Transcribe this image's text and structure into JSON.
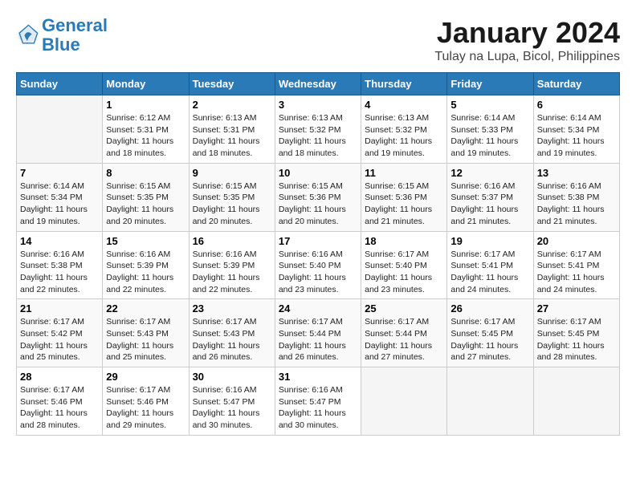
{
  "logo": {
    "line1": "General",
    "line2": "Blue"
  },
  "title": "January 2024",
  "subtitle": "Tulay na Lupa, Bicol, Philippines",
  "headers": [
    "Sunday",
    "Monday",
    "Tuesday",
    "Wednesday",
    "Thursday",
    "Friday",
    "Saturday"
  ],
  "weeks": [
    [
      {
        "day": "",
        "info": ""
      },
      {
        "day": "1",
        "info": "Sunrise: 6:12 AM\nSunset: 5:31 PM\nDaylight: 11 hours\nand 18 minutes."
      },
      {
        "day": "2",
        "info": "Sunrise: 6:13 AM\nSunset: 5:31 PM\nDaylight: 11 hours\nand 18 minutes."
      },
      {
        "day": "3",
        "info": "Sunrise: 6:13 AM\nSunset: 5:32 PM\nDaylight: 11 hours\nand 18 minutes."
      },
      {
        "day": "4",
        "info": "Sunrise: 6:13 AM\nSunset: 5:32 PM\nDaylight: 11 hours\nand 19 minutes."
      },
      {
        "day": "5",
        "info": "Sunrise: 6:14 AM\nSunset: 5:33 PM\nDaylight: 11 hours\nand 19 minutes."
      },
      {
        "day": "6",
        "info": "Sunrise: 6:14 AM\nSunset: 5:34 PM\nDaylight: 11 hours\nand 19 minutes."
      }
    ],
    [
      {
        "day": "7",
        "info": "Sunrise: 6:14 AM\nSunset: 5:34 PM\nDaylight: 11 hours\nand 19 minutes."
      },
      {
        "day": "8",
        "info": "Sunrise: 6:15 AM\nSunset: 5:35 PM\nDaylight: 11 hours\nand 20 minutes."
      },
      {
        "day": "9",
        "info": "Sunrise: 6:15 AM\nSunset: 5:35 PM\nDaylight: 11 hours\nand 20 minutes."
      },
      {
        "day": "10",
        "info": "Sunrise: 6:15 AM\nSunset: 5:36 PM\nDaylight: 11 hours\nand 20 minutes."
      },
      {
        "day": "11",
        "info": "Sunrise: 6:15 AM\nSunset: 5:36 PM\nDaylight: 11 hours\nand 21 minutes."
      },
      {
        "day": "12",
        "info": "Sunrise: 6:16 AM\nSunset: 5:37 PM\nDaylight: 11 hours\nand 21 minutes."
      },
      {
        "day": "13",
        "info": "Sunrise: 6:16 AM\nSunset: 5:38 PM\nDaylight: 11 hours\nand 21 minutes."
      }
    ],
    [
      {
        "day": "14",
        "info": "Sunrise: 6:16 AM\nSunset: 5:38 PM\nDaylight: 11 hours\nand 22 minutes."
      },
      {
        "day": "15",
        "info": "Sunrise: 6:16 AM\nSunset: 5:39 PM\nDaylight: 11 hours\nand 22 minutes."
      },
      {
        "day": "16",
        "info": "Sunrise: 6:16 AM\nSunset: 5:39 PM\nDaylight: 11 hours\nand 22 minutes."
      },
      {
        "day": "17",
        "info": "Sunrise: 6:16 AM\nSunset: 5:40 PM\nDaylight: 11 hours\nand 23 minutes."
      },
      {
        "day": "18",
        "info": "Sunrise: 6:17 AM\nSunset: 5:40 PM\nDaylight: 11 hours\nand 23 minutes."
      },
      {
        "day": "19",
        "info": "Sunrise: 6:17 AM\nSunset: 5:41 PM\nDaylight: 11 hours\nand 24 minutes."
      },
      {
        "day": "20",
        "info": "Sunrise: 6:17 AM\nSunset: 5:41 PM\nDaylight: 11 hours\nand 24 minutes."
      }
    ],
    [
      {
        "day": "21",
        "info": "Sunrise: 6:17 AM\nSunset: 5:42 PM\nDaylight: 11 hours\nand 25 minutes."
      },
      {
        "day": "22",
        "info": "Sunrise: 6:17 AM\nSunset: 5:43 PM\nDaylight: 11 hours\nand 25 minutes."
      },
      {
        "day": "23",
        "info": "Sunrise: 6:17 AM\nSunset: 5:43 PM\nDaylight: 11 hours\nand 26 minutes."
      },
      {
        "day": "24",
        "info": "Sunrise: 6:17 AM\nSunset: 5:44 PM\nDaylight: 11 hours\nand 26 minutes."
      },
      {
        "day": "25",
        "info": "Sunrise: 6:17 AM\nSunset: 5:44 PM\nDaylight: 11 hours\nand 27 minutes."
      },
      {
        "day": "26",
        "info": "Sunrise: 6:17 AM\nSunset: 5:45 PM\nDaylight: 11 hours\nand 27 minutes."
      },
      {
        "day": "27",
        "info": "Sunrise: 6:17 AM\nSunset: 5:45 PM\nDaylight: 11 hours\nand 28 minutes."
      }
    ],
    [
      {
        "day": "28",
        "info": "Sunrise: 6:17 AM\nSunset: 5:46 PM\nDaylight: 11 hours\nand 28 minutes."
      },
      {
        "day": "29",
        "info": "Sunrise: 6:17 AM\nSunset: 5:46 PM\nDaylight: 11 hours\nand 29 minutes."
      },
      {
        "day": "30",
        "info": "Sunrise: 6:16 AM\nSunset: 5:47 PM\nDaylight: 11 hours\nand 30 minutes."
      },
      {
        "day": "31",
        "info": "Sunrise: 6:16 AM\nSunset: 5:47 PM\nDaylight: 11 hours\nand 30 minutes."
      },
      {
        "day": "",
        "info": ""
      },
      {
        "day": "",
        "info": ""
      },
      {
        "day": "",
        "info": ""
      }
    ]
  ]
}
